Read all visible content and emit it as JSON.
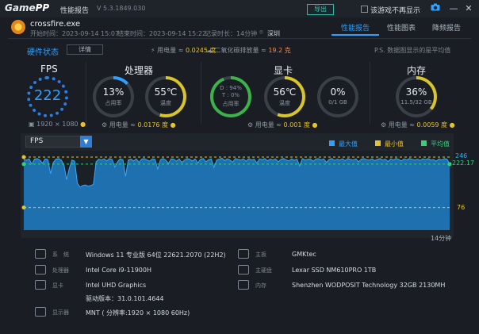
{
  "titlebar": {
    "logo_main": "Game",
    "logo_pp": "PP",
    "app_title": "性能报告",
    "version": "V 5.3.1849.030",
    "export_label": "导出",
    "no_popup_label": "该游戏不再显示",
    "icons": [
      "camera-icon",
      "minimize-icon",
      "close-icon"
    ]
  },
  "game": {
    "name": "crossfire.exe",
    "start_time": "开始时间：2023-09-14 15:07",
    "end_time": "结束时间：2023-09-14 15:22",
    "duration": "记录时长：14分钟",
    "location": "深圳"
  },
  "tabs": [
    {
      "label": "性能报告",
      "active": true
    },
    {
      "label": "性能图表",
      "active": false
    },
    {
      "label": "降频报告",
      "active": false
    }
  ],
  "status": {
    "hw_status": "硬件状态",
    "details_button": "详情",
    "total_power_prefix": "用电量 ≈ ",
    "total_power_value": "0.0245 度",
    "co2_prefix": "二氧化碳排放量 ≈ ",
    "co2_value": "19.2 克",
    "data_note": "P.S. 数据图显示的是平均值"
  },
  "fps_panel": {
    "title": "FPS",
    "value": "222",
    "resolution": "1920 × 1080"
  },
  "cpu_panel": {
    "title": "处理器",
    "usage_value": "13%",
    "usage_label": "占用率",
    "usage_fraction": 0.13,
    "temp_value": "55℃",
    "temp_label": "温度",
    "power_prefix": "用电量 ≈ ",
    "power_value": "0.0176 度"
  },
  "gpu_panel": {
    "title": "显卡",
    "d_line": "D : 94%",
    "t_line": "T : 0%",
    "usage_label": "占用率",
    "temp_value": "56℃",
    "temp_label": "温度",
    "vram_value": "0%",
    "vram_label": "0/1 GB",
    "power_prefix": "用电量 ≈ ",
    "power_value": "0.001 度"
  },
  "mem_panel": {
    "title": "内存",
    "usage_value": "36%",
    "usage_label": "11.5/32 GB",
    "power_prefix": "用电量 ≈ ",
    "power_value": "0.0059 度"
  },
  "chart_data": {
    "type": "area",
    "metric": "FPS",
    "legend": [
      {
        "label": "最大值",
        "color": "#2ea0ff"
      },
      {
        "label": "最小值",
        "color": "#e7c32b"
      },
      {
        "label": "平均值",
        "color": "#33d17a"
      }
    ],
    "ylim": [
      0,
      262
    ],
    "max_line": 246,
    "max_label": "246",
    "avg_line": 222.17,
    "avg_label": "222.17",
    "min_line": 76,
    "min_label": "76",
    "x_end_label": "14分钟",
    "series": [
      {
        "values": [
          238,
          236,
          240,
          222,
          239,
          241,
          236,
          225,
          240,
          237,
          190,
          228,
          239,
          241,
          236,
          219,
          170,
          208,
          236,
          232,
          158,
          145,
          150,
          152,
          148,
          150,
          154,
          230,
          239,
          236,
          240,
          233,
          241,
          238,
          212,
          230,
          240,
          237,
          181,
          236,
          239,
          233,
          240,
          228,
          239,
          241,
          236,
          232,
          240,
          238,
          206,
          237,
          241,
          236,
          225,
          240,
          239,
          232,
          240,
          228,
          236,
          241,
          238,
          233,
          240,
          226,
          239,
          241,
          230,
          237,
          240,
          211,
          236,
          239,
          242,
          234,
          240,
          236,
          229,
          241,
          238,
          236,
          240,
          232,
          241,
          236,
          239,
          226,
          240,
          237,
          241,
          233,
          239,
          236,
          240,
          230,
          238,
          241,
          236,
          233,
          240,
          235,
          239,
          216,
          241,
          236,
          238,
          240,
          232,
          239,
          241,
          236,
          240,
          228,
          238,
          241,
          235,
          239,
          236,
          240,
          234,
          241,
          238,
          236,
          240,
          230,
          239,
          241,
          237,
          236,
          240,
          234,
          238,
          241,
          236,
          239,
          231,
          240,
          236,
          241,
          238,
          233,
          240,
          236,
          241,
          238,
          236,
          239,
          235,
          240,
          237,
          241,
          236,
          238,
          232,
          240,
          236,
          241,
          239,
          224
        ]
      }
    ]
  },
  "system_info": [
    {
      "icon": "system-icon",
      "label": "系　统",
      "value": "Windows 11 专业版 64位 22621.2070 (22H2)"
    },
    {
      "icon": "motherboard-icon",
      "label": "主板",
      "value": "GMKtec"
    },
    {
      "icon": "cpu-icon",
      "label": "处理器",
      "value": "Intel Core i9-11900H"
    },
    {
      "icon": "disk-icon",
      "label": "主硬盘",
      "value": "Lexar SSD NM610PRO 1TB"
    },
    {
      "icon": "gpu-icon",
      "label": "显卡",
      "value": "Intel UHD Graphics"
    },
    {
      "icon": "memory-icon",
      "label": "内存",
      "value": "Shenzhen WODPOSIT Technology 32GB 2130MH"
    },
    {
      "icon": "driver-icon",
      "label": "",
      "value": "驱动版本：31.0.101.4644"
    },
    {
      "icon": "monitor-icon",
      "label": "显示器",
      "value": "MNT ( 分辨率:1920 × 1080 60Hz)"
    }
  ]
}
